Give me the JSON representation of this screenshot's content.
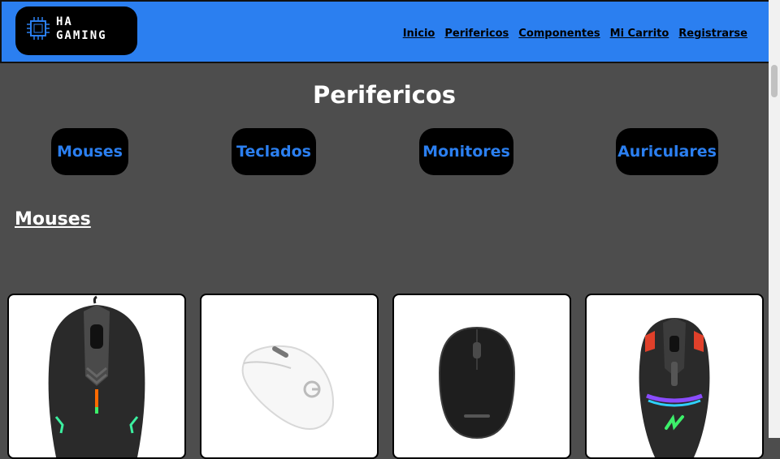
{
  "brand": {
    "line1": "HA",
    "line2": "GAMING"
  },
  "nav": [
    "Inicio",
    "Perifericos",
    "Componentes",
    "Mi Carrito",
    "Registrarse"
  ],
  "page_title": "Perifericos",
  "categories": [
    "Mouses",
    "Teclados",
    "Monitores",
    "Auriculares"
  ],
  "section_title": "Mouses",
  "products": [
    {
      "icon": "black-gaming-mouse-image"
    },
    {
      "icon": "white-logitech-mouse-image"
    },
    {
      "icon": "black-logitech-mouse-image"
    },
    {
      "icon": "rgb-gaming-mouse-image"
    }
  ],
  "colors": {
    "accent": "#2b7ff0",
    "background": "#4d4d4d"
  }
}
